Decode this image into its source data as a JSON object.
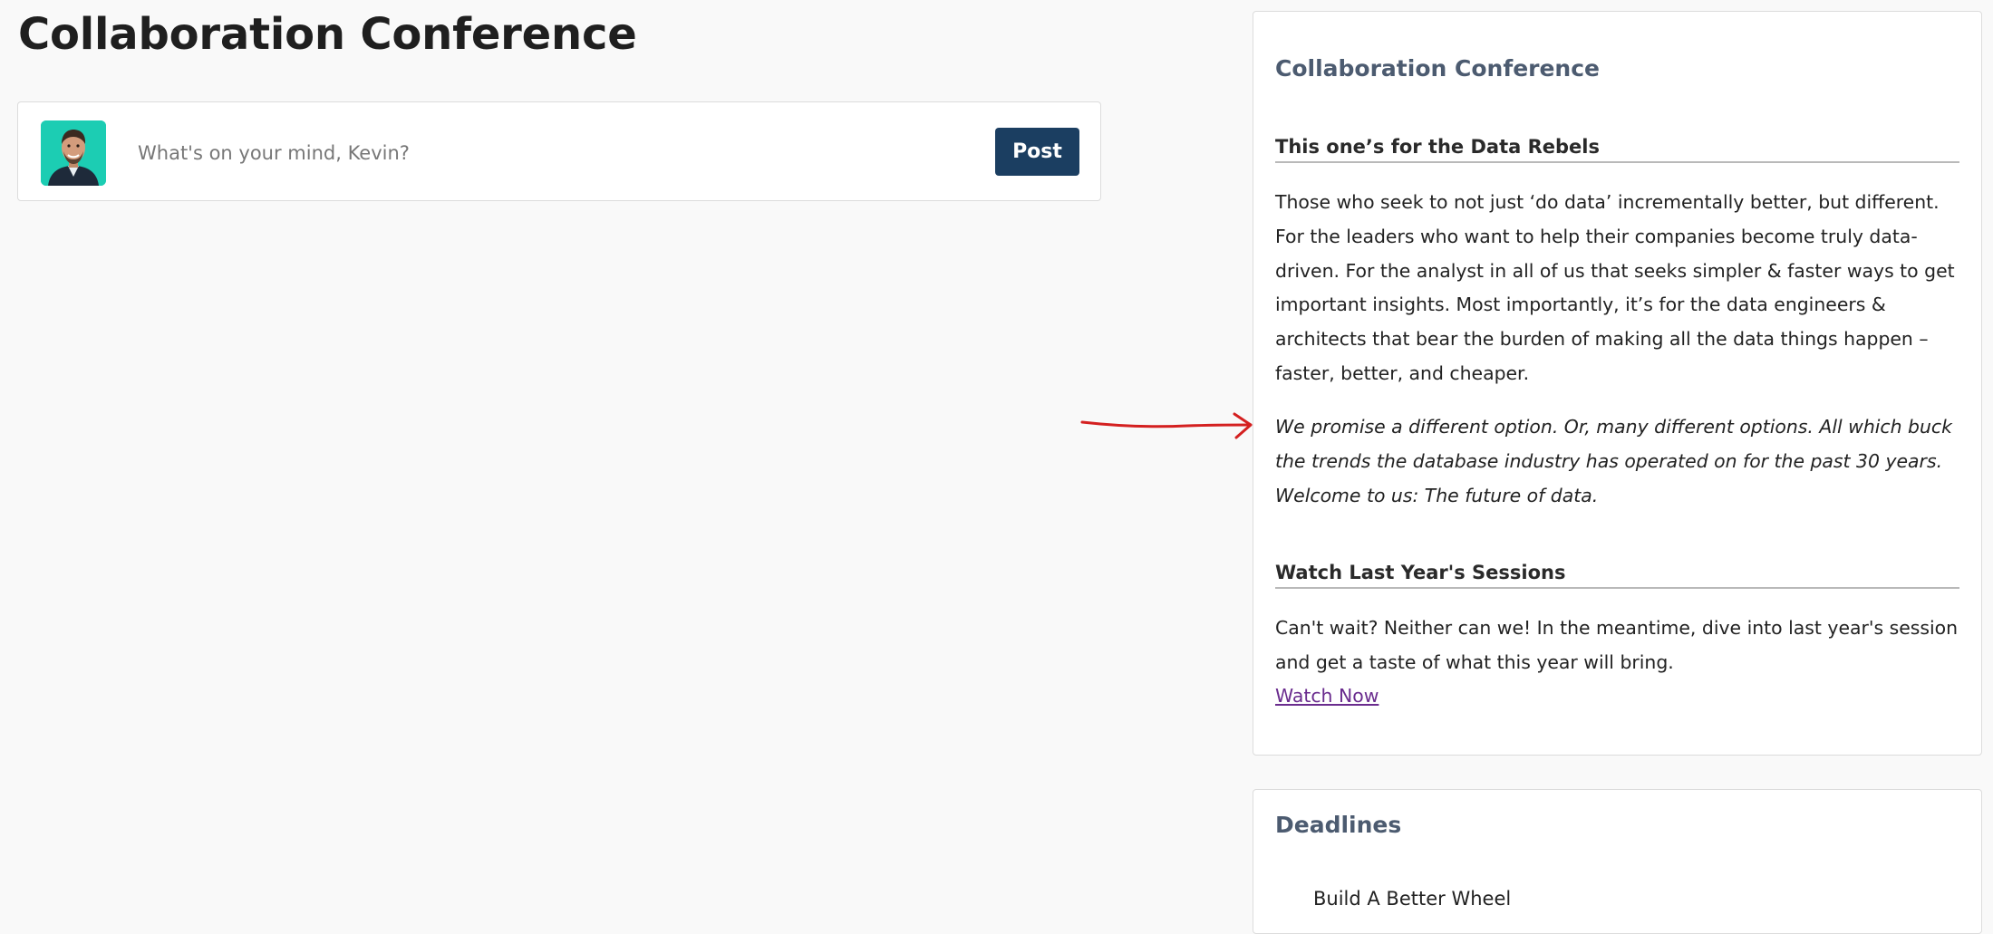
{
  "page": {
    "title": "Collaboration Conference"
  },
  "composer": {
    "placeholder": "What's on your mind, Kevin?",
    "post_label": "Post",
    "avatar_bg": "#1ccdb3"
  },
  "about_card": {
    "heading": "Collaboration Conference",
    "section1": {
      "heading": "This one’s for the Data Rebels",
      "paragraph": "Those who seek to not just ‘do data’ incrementally better, but different. For the leaders who want to help their companies become truly data-driven. For the analyst in all of us that seeks simpler & faster ways to get important insights. Most importantly, it’s for the data engineers & architects that bear the burden of making all the data things happen – faster, better, and cheaper.",
      "italic_paragraph": "We promise a different option. Or, many different options. All which buck the trends the database industry has operated on for the past 30 years. Welcome to us: The future of data."
    },
    "section2": {
      "heading": "Watch Last Year's Sessions",
      "paragraph": "Can't wait? Neither can we! In the meantime, dive into last year's session and get a taste of what this year will bring.",
      "link_label": "Watch Now"
    }
  },
  "deadlines_card": {
    "heading": "Deadlines",
    "items": [
      "Build A Better Wheel"
    ]
  },
  "colors": {
    "post_button": "#1b3e61",
    "heading_slate": "#4c5b70",
    "link": "#6a2c8e",
    "annotation_arrow": "#d42020",
    "page_bg": "#f9f9f9"
  }
}
